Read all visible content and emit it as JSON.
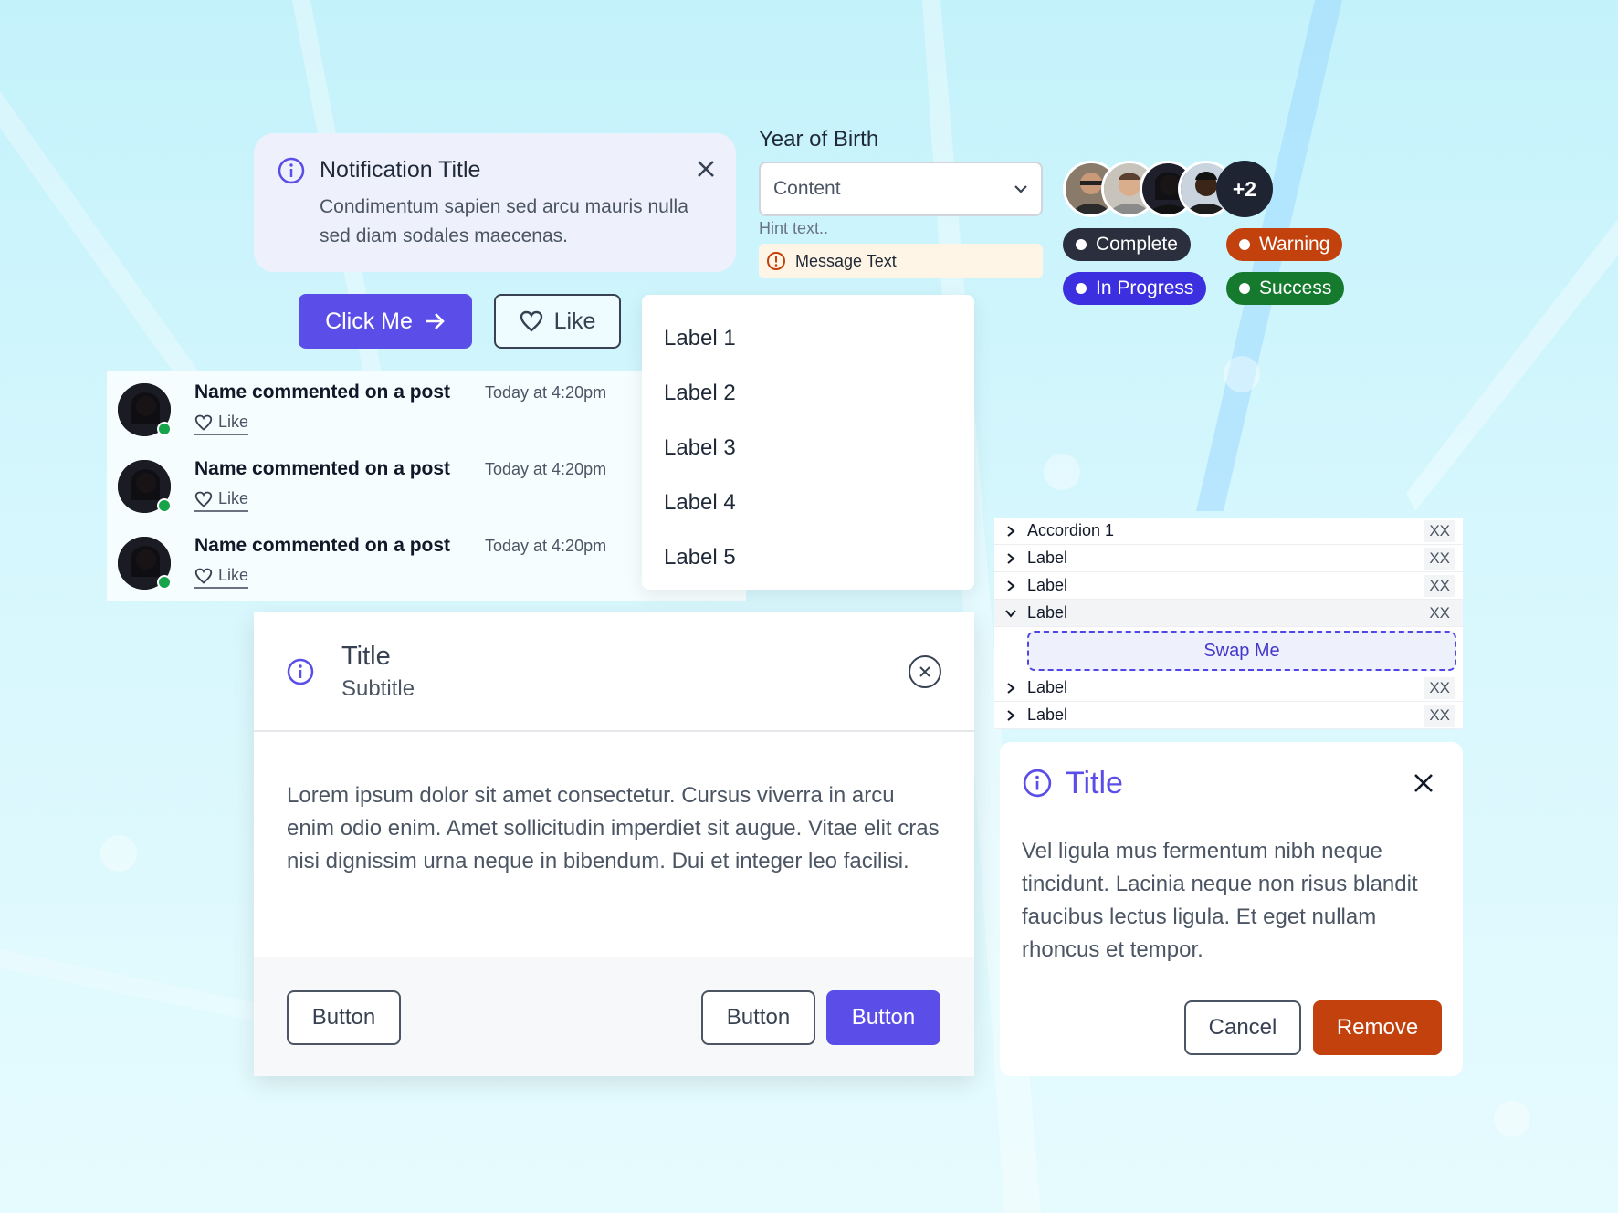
{
  "notification": {
    "title": "Notification Title",
    "body": "Condimentum sapien sed arcu mauris nulla sed diam sodales maecenas."
  },
  "buttons": {
    "primary_label": "Click Me",
    "like_label": "Like"
  },
  "select": {
    "label": "Year of Birth",
    "value": "Content",
    "hint": "Hint text..",
    "message": "Message Text"
  },
  "avatar_group": {
    "more": "+2"
  },
  "badges": [
    {
      "label": "Complete",
      "color": "#2b2f3d"
    },
    {
      "label": "Warning",
      "color": "#c2410c"
    },
    {
      "label": "In Progress",
      "color": "#3b2fe0"
    },
    {
      "label": "Success",
      "color": "#157a2e"
    }
  ],
  "feed": [
    {
      "name": "Name commented on a post",
      "time": "Today at 4:20pm",
      "like": "Like"
    },
    {
      "name": "Name commented on a post",
      "time": "Today at 4:20pm",
      "like": "Like"
    },
    {
      "name": "Name commented on a post",
      "time": "Today at 4:20pm",
      "like": "Like"
    }
  ],
  "dropdown": {
    "items": [
      "Label 1",
      "Label 2",
      "Label 3",
      "Label 4",
      "Label 5"
    ]
  },
  "modal": {
    "title": "Title",
    "subtitle": "Subtitle",
    "body": "Lorem ipsum dolor sit amet consectetur. Cursus viverra in arcu enim odio enim. Amet sollicitudin imperdiet sit augue. Vitae elit cras nisi dignissim urna neque in bibendum. Dui et integer leo facilisi.",
    "button_left": "Button",
    "button_secondary": "Button",
    "button_primary": "Button"
  },
  "accordion": {
    "rows": [
      {
        "label": "Accordion 1",
        "tag": "XX"
      },
      {
        "label": "Label",
        "tag": "XX"
      },
      {
        "label": "Label",
        "tag": "XX"
      },
      {
        "label": "Label",
        "tag": "XX"
      },
      {
        "label": "Label",
        "tag": "XX"
      },
      {
        "label": "Label",
        "tag": "XX"
      }
    ],
    "swap": "Swap Me"
  },
  "dialog": {
    "title": "Title",
    "body": "Vel ligula mus fermentum nibh neque tincidunt. Lacinia neque non risus blandit faucibus lectus ligula. Et eget nullam rhoncus et tempor.",
    "cancel": "Cancel",
    "remove": "Remove"
  },
  "colors": {
    "accent": "#5b4ee8",
    "danger": "#c2410c",
    "online": "#16a34a"
  }
}
